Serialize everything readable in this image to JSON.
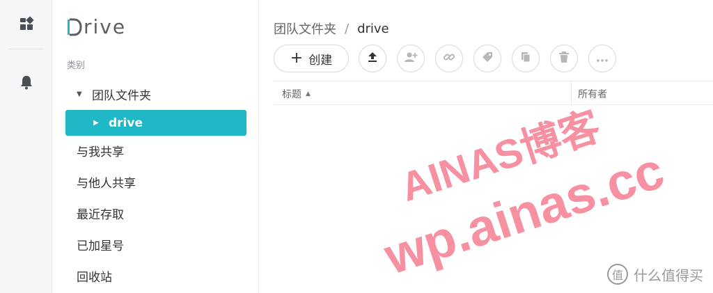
{
  "rail": {
    "items": [
      {
        "icon": "dashboard-icon"
      },
      {
        "icon": "bell-icon"
      }
    ]
  },
  "sidebar": {
    "logo_text": "rive",
    "section_label": "类别",
    "tree": {
      "root_label": "团队文件夹",
      "child_label": "drive"
    },
    "items": [
      {
        "label": "与我共享"
      },
      {
        "label": "与他人共享"
      },
      {
        "label": "最近存取"
      },
      {
        "label": "已加星号"
      },
      {
        "label": "回收站"
      }
    ]
  },
  "breadcrumb": {
    "parent": "团队文件夹",
    "separator": "/",
    "current": "drive"
  },
  "toolbar": {
    "create_label": "创建",
    "buttons": [
      {
        "icon": "upload-icon",
        "enabled": true
      },
      {
        "icon": "add-user-icon",
        "enabled": false
      },
      {
        "icon": "link-icon",
        "enabled": false
      },
      {
        "icon": "tag-icon",
        "enabled": false
      },
      {
        "icon": "copy-icon",
        "enabled": false
      },
      {
        "icon": "trash-icon",
        "enabled": false
      },
      {
        "icon": "more-icon",
        "enabled": false
      }
    ]
  },
  "table": {
    "columns": [
      "标题",
      "所有者"
    ],
    "sort_indicator": "▲"
  },
  "watermark": {
    "line1": "AINAS博客",
    "line2": "wp.ainas.cc",
    "corner_badge": "值",
    "corner_text": "什么值得买"
  },
  "colors": {
    "accent": "#1fb8c6",
    "watermark": "#f5788c"
  }
}
